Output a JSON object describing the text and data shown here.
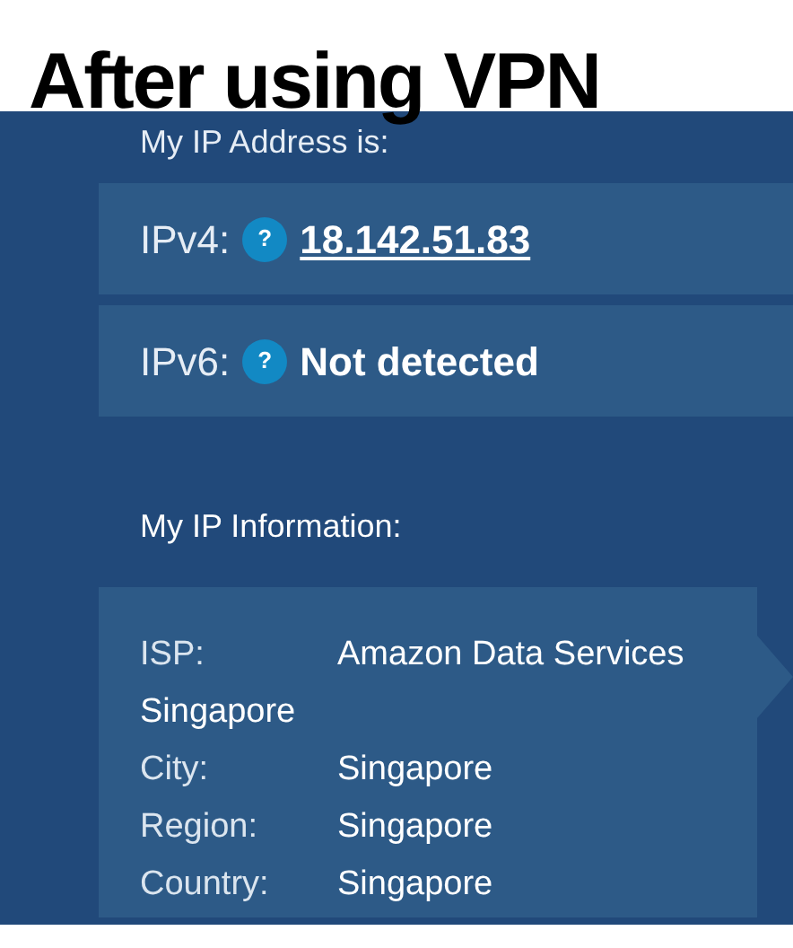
{
  "caption": "After using VPN",
  "address": {
    "heading": "My IP Address is:",
    "rows": [
      {
        "label": "IPv4:",
        "help": "?",
        "value": "18.142.51.83",
        "kind": "link"
      },
      {
        "label": "IPv6:",
        "help": "?",
        "value": "Not detected",
        "kind": "plain"
      }
    ]
  },
  "information": {
    "heading": "My IP Information:",
    "rows": [
      {
        "label": "ISP:",
        "value": "Amazon Data Services Singapore"
      },
      {
        "label": "City:",
        "value": "Singapore"
      },
      {
        "label": "Region:",
        "value": "Singapore"
      },
      {
        "label": "Country:",
        "value": "Singapore"
      }
    ]
  }
}
